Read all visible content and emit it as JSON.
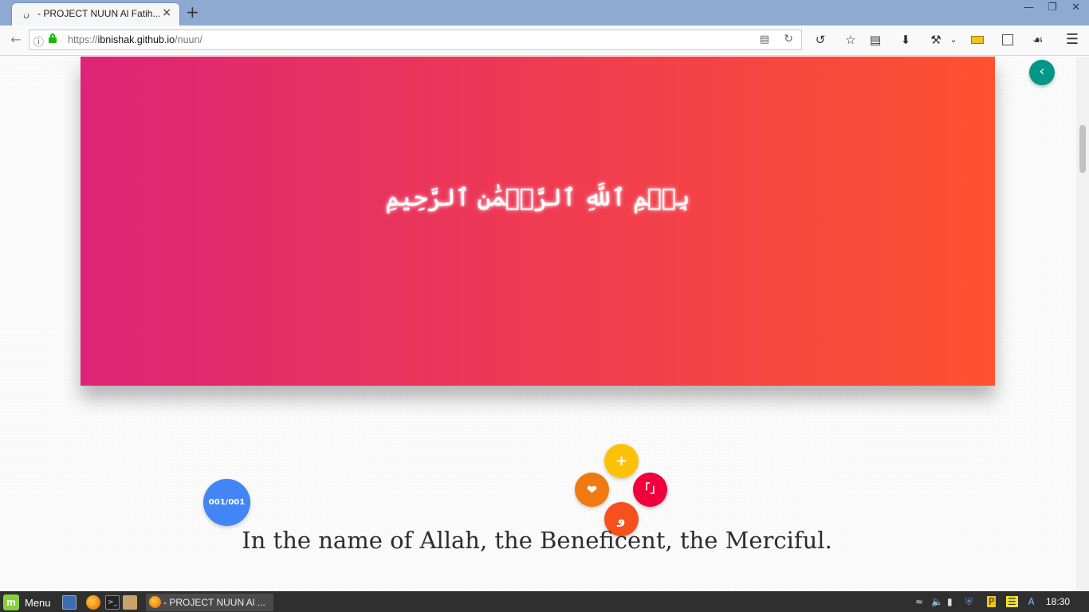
{
  "browser": {
    "tab": {
      "favicon": "ن",
      "title": "- PROJECT NUUN Al Fatih...",
      "close": "×"
    },
    "new_tab": "+",
    "window_controls": {
      "minimize": "—",
      "restore": "❐",
      "close": "✕"
    },
    "url": {
      "prefix": "https://",
      "host": "ibnishak.github.io",
      "path": "/nuun/"
    },
    "icons": [
      "back-icon",
      "info-icon",
      "lock-icon",
      "reader-view-icon",
      "reload-icon",
      "history-icon",
      "bookmark-star-icon",
      "library-icon",
      "download-icon",
      "tools-icon",
      "chevron-down-icon",
      "ruler-icon",
      "screenshot-icon",
      "tag-icon",
      "hamburger-menu-icon"
    ]
  },
  "page": {
    "bismillah": "بِسۡمِ ٱللَّهِ ٱلرَّحۡمَٰنِ ٱلرَّحِيمِ",
    "counter": "001/001",
    "translation": "In the name of Allah, the Beneficent, the Merciful.",
    "fab_labels": {
      "plus": "+",
      "heart": "❤",
      "quote": "「」",
      "translate": "ﻭ"
    },
    "colors": {
      "gradient_start": "#dd2476",
      "gradient_end": "#ff512f",
      "back_button": "#009688",
      "counter": "#4285f4",
      "plus": "#ffc107",
      "heart": "#ef7a12",
      "quote": "#f0003c",
      "translate": "#f4511e"
    }
  },
  "taskbar": {
    "menu_label": "Menu",
    "window_item": "- PROJECT NUUN Al ...",
    "clock": "18:30"
  }
}
